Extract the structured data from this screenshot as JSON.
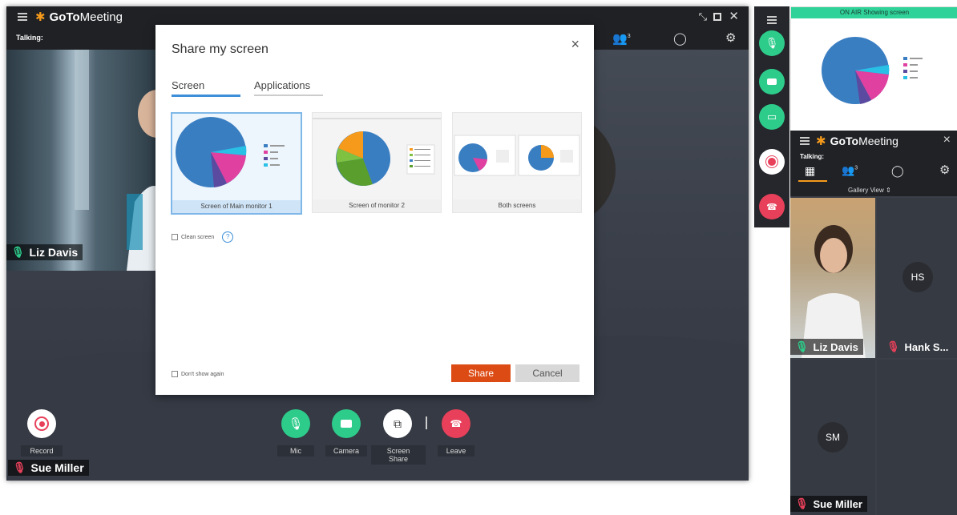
{
  "main_window": {
    "app_name_bold": "GoTo",
    "app_name_rest": "Meeting",
    "talking_label": "Talking:",
    "toolbar_attendee_count": "3",
    "participants": {
      "liz": "Liz  Davis",
      "sue": "Sue Miller"
    },
    "controls": {
      "record": "Record",
      "mic": "Mic",
      "camera": "Camera",
      "screen_share": "Screen Share",
      "leave": "Leave"
    }
  },
  "dialog": {
    "title": "Share my screen",
    "close": "×",
    "tabs": [
      "Screen",
      "Applications"
    ],
    "thumbnails": [
      {
        "caption": "Screen of Main monitor 1",
        "selected": true
      },
      {
        "caption": "Screen of monitor 2",
        "selected": false
      },
      {
        "caption": "Both screens",
        "selected": false
      }
    ],
    "clean_screen": "Clean screen",
    "help": "?",
    "dont_show_again": "Don't show again",
    "share_button": "Share",
    "cancel_button": "Cancel"
  },
  "side_panel": {
    "on_air_banner": "ON AIR  Showing screen",
    "app_name_bold": "GoTo",
    "app_name_rest": "Meeting",
    "close": "×",
    "talking_label": "Talking:",
    "attendee_count": "3",
    "view_label": "Gallery View",
    "participants": [
      {
        "name": "Liz  Davis",
        "initials": ""
      },
      {
        "name": "Hank S...",
        "initials": "HS"
      },
      {
        "name": "Sue Miller",
        "initials": "SM"
      }
    ]
  },
  "colors": {
    "accent_orange": "#dd4b14",
    "green": "#2ecc8b",
    "red": "#e8405a",
    "on_air": "#2fd39a"
  }
}
